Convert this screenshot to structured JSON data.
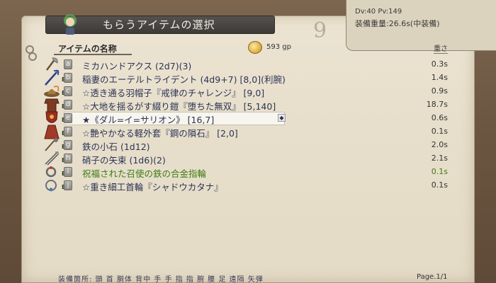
{
  "window": {
    "title": "もらうアイテムの選択"
  },
  "status": {
    "dv_pv": "Dv:40 Pv:149",
    "equip_weight": "装備重量:26.6s(中装備)"
  },
  "list_header": {
    "name_label": "アイテムの名称",
    "gold": "593 gp",
    "weight_label": "重さ"
  },
  "items": [
    {
      "key": "a",
      "equipped": false,
      "name": "ミカハンドアクス (2d7)(3)",
      "weight": "0.3s",
      "blessed": false,
      "icon": "axe-icon"
    },
    {
      "key": "b",
      "equipped": true,
      "name": "稲妻のエーテルトライデント (4d9+7) [8,0](利腕)",
      "weight": "1.4s",
      "blessed": false,
      "icon": "trident-icon"
    },
    {
      "key": "c",
      "equipped": true,
      "name": "☆透き通る羽帽子『戒律のチャレンジ』 [9,0]",
      "weight": "0.9s",
      "blessed": false,
      "icon": "hat-icon"
    },
    {
      "key": "d",
      "equipped": true,
      "name": "☆大地を揺るがす綴り鎧『堕ちた無双』 [5,140]",
      "weight": "18.7s",
      "blessed": false,
      "icon": "armor-icon"
    },
    {
      "key": "e",
      "equipped": true,
      "name": "★《ダル=イ=サリオン》 [16,7]",
      "weight": "0.6s",
      "blessed": false,
      "icon": "shield-icon"
    },
    {
      "key": "f",
      "equipped": true,
      "name": "☆艶やかなる軽外套『鋼の隕石』 [2,0]",
      "weight": "0.1s",
      "blessed": false,
      "icon": "cloak-icon"
    },
    {
      "key": "g",
      "equipped": true,
      "name": "鉄の小石 (1d12)",
      "weight": "2.0s",
      "blessed": false,
      "icon": "stone-icon"
    },
    {
      "key": "h",
      "equipped": true,
      "name": "硝子の矢束 (1d6)(2)",
      "weight": "2.1s",
      "blessed": false,
      "icon": "arrows-icon"
    },
    {
      "key": "i",
      "equipped": true,
      "name": "祝福された召使の鉄の合金指輪",
      "weight": "0.1s",
      "blessed": true,
      "icon": "ring-icon"
    },
    {
      "key": "j",
      "equipped": true,
      "name": "☆重き細工首輪『シャドウカタナ』",
      "weight": "0.1s",
      "blessed": false,
      "icon": "amulet-icon"
    }
  ],
  "footer": {
    "slots": "装備箇所: 頭 首 胴体 背中 手 手 指 指 腕 腰 足 遠隔 矢弾",
    "page": "Page.1/1"
  },
  "colors": {
    "parchment": "#e8e0cc",
    "banner": "#45413e",
    "item_text": "#2c3356",
    "blessed_text": "#3e7a16"
  }
}
